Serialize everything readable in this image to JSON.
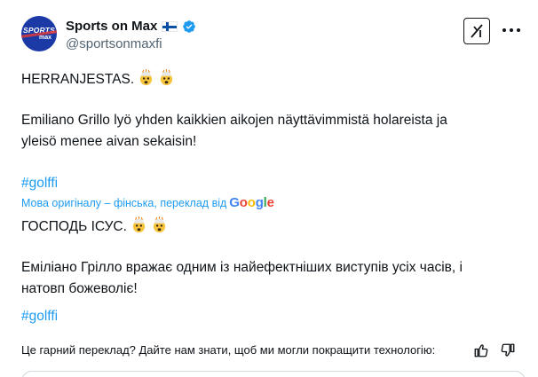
{
  "author": {
    "display_name": "Sports on Max",
    "handle": "@sportsonmaxfi",
    "avatar_text_top": "SPORTS",
    "avatar_text_bottom": "max"
  },
  "original": {
    "line1": "HERRANJESTAS.",
    "line2": "Emiliano Grillo lyö yhden kaikkien aikojen näyttävimmistä holareista ja",
    "line3": "yleisö menee aivan sekaisin!",
    "hashtag": "#golffi"
  },
  "translation": {
    "notice": "Мова оригіналу – фінська, переклад від",
    "google": [
      "G",
      "o",
      "o",
      "g",
      "l",
      "e"
    ],
    "line1": "ГОСПОДЬ ІСУС.",
    "line2": "Еміліано Грілло вражає одним із найефектніших виступів усіх часів, і",
    "line3": "натовп божеволіє!",
    "hashtag": "#golffi"
  },
  "feedback": {
    "prompt": "Це гарний переклад? Дайте нам знати, щоб ми могли покращити технологію:"
  },
  "colors": {
    "link": "#1d9bf0",
    "text": "#0f1419",
    "secondary": "#536471",
    "avatar_bg": "#1b3aa6"
  },
  "icons": [
    "flag-finland-icon",
    "verified-badge-icon",
    "grok-icon",
    "more-icon",
    "exploding-head-emoji",
    "thumbs-up-icon",
    "thumbs-down-icon"
  ]
}
